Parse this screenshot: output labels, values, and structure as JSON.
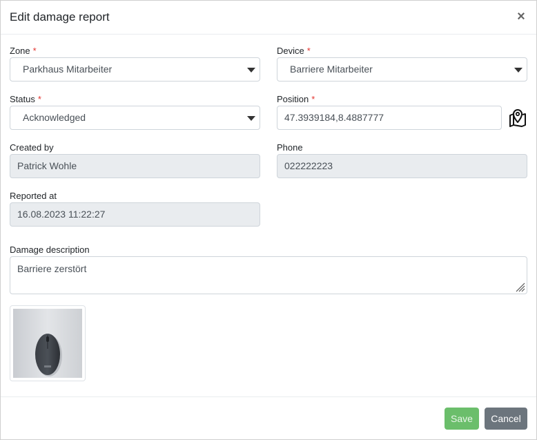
{
  "modal": {
    "title": "Edit damage report"
  },
  "form": {
    "zone": {
      "label": "Zone",
      "required_mark": "*",
      "value": "Parkhaus Mitarbeiter"
    },
    "device": {
      "label": "Device",
      "required_mark": "*",
      "value": "Barriere Mitarbeiter"
    },
    "status": {
      "label": "Status",
      "required_mark": "*",
      "value": "Acknowledged"
    },
    "position": {
      "label": "Position",
      "required_mark": "*",
      "value": "47.3939184,8.4887777"
    },
    "created_by": {
      "label": "Created by",
      "value": "Patrick Wohle"
    },
    "phone": {
      "label": "Phone",
      "value": "022222223"
    },
    "reported_at": {
      "label": "Reported at",
      "value": "16.08.2023 11:22:27"
    },
    "description": {
      "label": "Damage description",
      "value": "Barriere zerstört"
    }
  },
  "icons": {
    "close": "close-icon",
    "map": "map-pin-icon",
    "caret": "chevron-down-icon"
  },
  "footer": {
    "save_label": "Save",
    "cancel_label": "Cancel"
  },
  "colors": {
    "required": "#e3342f",
    "save": "#5cb85c",
    "cancel": "#6c757d",
    "readonly_bg": "#e9ecef"
  }
}
